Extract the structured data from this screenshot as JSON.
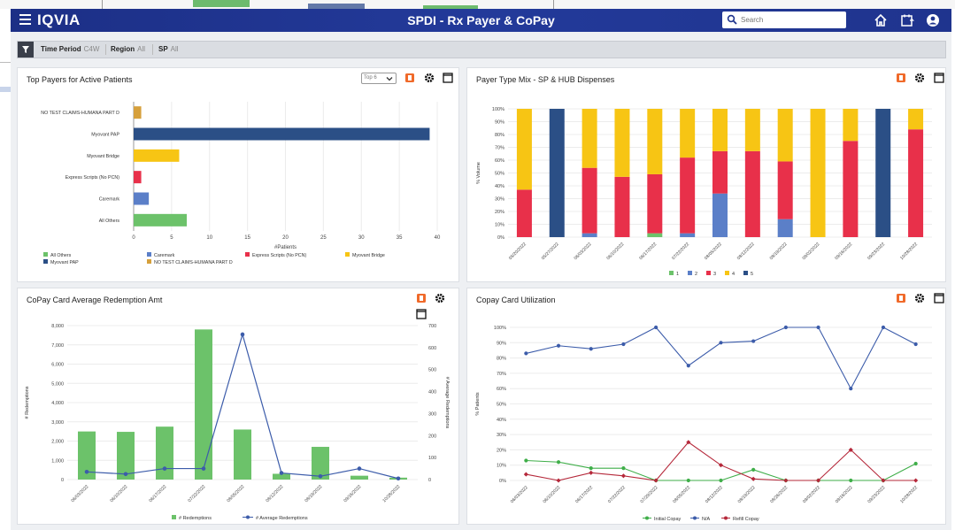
{
  "header": {
    "logo": "IQVIA",
    "title": "SPDI - Rx Payer & CoPay",
    "search_placeholder": "Search"
  },
  "filters": [
    {
      "label": "Time Period",
      "value": "C4W"
    },
    {
      "label": "Region",
      "value": "All"
    },
    {
      "label": "SP",
      "value": "All"
    }
  ],
  "panels": {
    "top_payers": {
      "title": "Top Payers for Active Patients",
      "select_value": "Top 6"
    },
    "payer_type": {
      "title": "Payer Type Mix - SP & HUB Dispenses"
    },
    "copay_avg": {
      "title": "CoPay Card Average Redemption Amt"
    },
    "copay_util": {
      "title": "Copay Card Utilization"
    }
  },
  "colors": {
    "green": "#6cc26a",
    "blue": "#5b7fc8",
    "red": "#e8304a",
    "yellow": "#f7c514",
    "navy": "#2b4f86",
    "tan": "#d6a03c",
    "line_blue": "#3c5caa",
    "line_green": "#3fae49",
    "line_red": "#b5283a"
  },
  "chart_data": [
    {
      "type": "bar",
      "orientation": "horizontal",
      "categories": [
        "NO TEST CLAIMS-HUMANA PART D",
        "Myovant PAP",
        "Myovant Bridge",
        "Express Scripts (No PCN)",
        "Caremark",
        "All Others"
      ],
      "values": [
        1,
        39,
        6,
        1,
        2,
        7
      ],
      "bar_colors": [
        "tan",
        "navy",
        "yellow",
        "red",
        "blue",
        "green"
      ],
      "xlabel": "#Patients",
      "xlim": [
        0,
        40
      ],
      "xticks": [
        "0",
        "5",
        "10",
        "15",
        "20",
        "25",
        "30",
        "35",
        "40"
      ],
      "legend": [
        "All Others",
        "Caremark",
        "Express Scripts (No PCN)",
        "Myovant Bridge",
        "Myovant PAP",
        "NO TEST CLAIMS-HUMANA PART D"
      ],
      "legend_colors": [
        "green",
        "blue",
        "red",
        "yellow",
        "navy",
        "tan"
      ]
    },
    {
      "type": "bar",
      "stacked": true,
      "percent": true,
      "categories": [
        "05/20/2022",
        "05/27/2022",
        "06/03/2022",
        "06/10/2022",
        "06/17/2022",
        "07/22/2022",
        "08/05/2022",
        "08/12/2022",
        "08/19/2022",
        "09/02/2022",
        "09/16/2022",
        "09/23/2022",
        "10/28/2022"
      ],
      "ylabel": "% Volume",
      "yticks": [
        "0%",
        "10%",
        "20%",
        "30%",
        "40%",
        "50%",
        "60%",
        "70%",
        "80%",
        "90%",
        "100%"
      ],
      "series": [
        {
          "name": "1",
          "color": "green",
          "values": [
            0,
            0,
            0,
            0,
            3,
            0,
            0,
            0,
            0,
            0,
            0,
            0,
            0
          ]
        },
        {
          "name": "2",
          "color": "blue",
          "values": [
            0,
            0,
            3,
            0,
            0,
            3,
            34,
            0,
            14,
            0,
            0,
            0,
            0
          ]
        },
        {
          "name": "3",
          "color": "red",
          "values": [
            37,
            0,
            51,
            47,
            46,
            59,
            33,
            67,
            45,
            0,
            75,
            0,
            84
          ]
        },
        {
          "name": "4",
          "color": "yellow",
          "values": [
            63,
            0,
            46,
            53,
            51,
            38,
            33,
            33,
            41,
            100,
            25,
            0,
            16
          ]
        },
        {
          "name": "5",
          "color": "navy",
          "values": [
            0,
            100,
            0,
            0,
            0,
            0,
            0,
            0,
            0,
            0,
            0,
            100,
            0
          ]
        }
      ]
    },
    {
      "type": "bar",
      "combo": "bar+line",
      "categories": [
        "06/03/2022",
        "06/10/2022",
        "06/17/2022",
        "07/22/2022",
        "08/05/2022",
        "08/12/2022",
        "08/19/2022",
        "09/16/2022",
        "10/28/2022"
      ],
      "ylabel": "# Redemptions",
      "y2label": "# Average Redemptions",
      "ylim": [
        0,
        8000
      ],
      "y2lim": [
        0,
        700
      ],
      "yticks": [
        "0",
        "1,000",
        "2,000",
        "3,000",
        "4,000",
        "5,000",
        "6,000",
        "7,000",
        "8,000"
      ],
      "y2ticks": [
        "0",
        "100",
        "200",
        "300",
        "400",
        "500",
        "600",
        "700"
      ],
      "series": [
        {
          "name": "# Redemptions",
          "color": "green",
          "kind": "bar",
          "values": [
            2500,
            2480,
            2750,
            7800,
            2600,
            300,
            1700,
            200,
            100
          ]
        },
        {
          "name": "# Average Redemptions",
          "color": "line_blue",
          "kind": "line",
          "axis": "y2",
          "values": [
            35,
            25,
            50,
            50,
            660,
            30,
            15,
            50,
            5
          ]
        }
      ]
    },
    {
      "type": "line",
      "categories": [
        "06/03/2022",
        "06/10/2022",
        "06/17/2022",
        "07/22/2022",
        "07/29/2022",
        "08/05/2022",
        "08/12/2022",
        "08/19/2022",
        "08/26/2022",
        "09/02/2022",
        "09/16/2022",
        "09/23/2022",
        "10/28/2022"
      ],
      "ylabel": "% Patients",
      "yticks": [
        "0%",
        "10%",
        "20%",
        "30%",
        "40%",
        "50%",
        "60%",
        "70%",
        "80%",
        "90%",
        "100%"
      ],
      "series": [
        {
          "name": "Initial Copay",
          "color": "line_green",
          "values": [
            13,
            12,
            8,
            8,
            0,
            0,
            0,
            7,
            0,
            0,
            0,
            0,
            11
          ]
        },
        {
          "name": "N/A",
          "color": "line_blue",
          "values": [
            83,
            88,
            86,
            89,
            100,
            75,
            90,
            91,
            100,
            100,
            60,
            100,
            89
          ]
        },
        {
          "name": "Refill Copay",
          "color": "line_red",
          "values": [
            4,
            0,
            5,
            3,
            0,
            25,
            10,
            1,
            0,
            0,
            20,
            0,
            0
          ]
        }
      ]
    }
  ]
}
